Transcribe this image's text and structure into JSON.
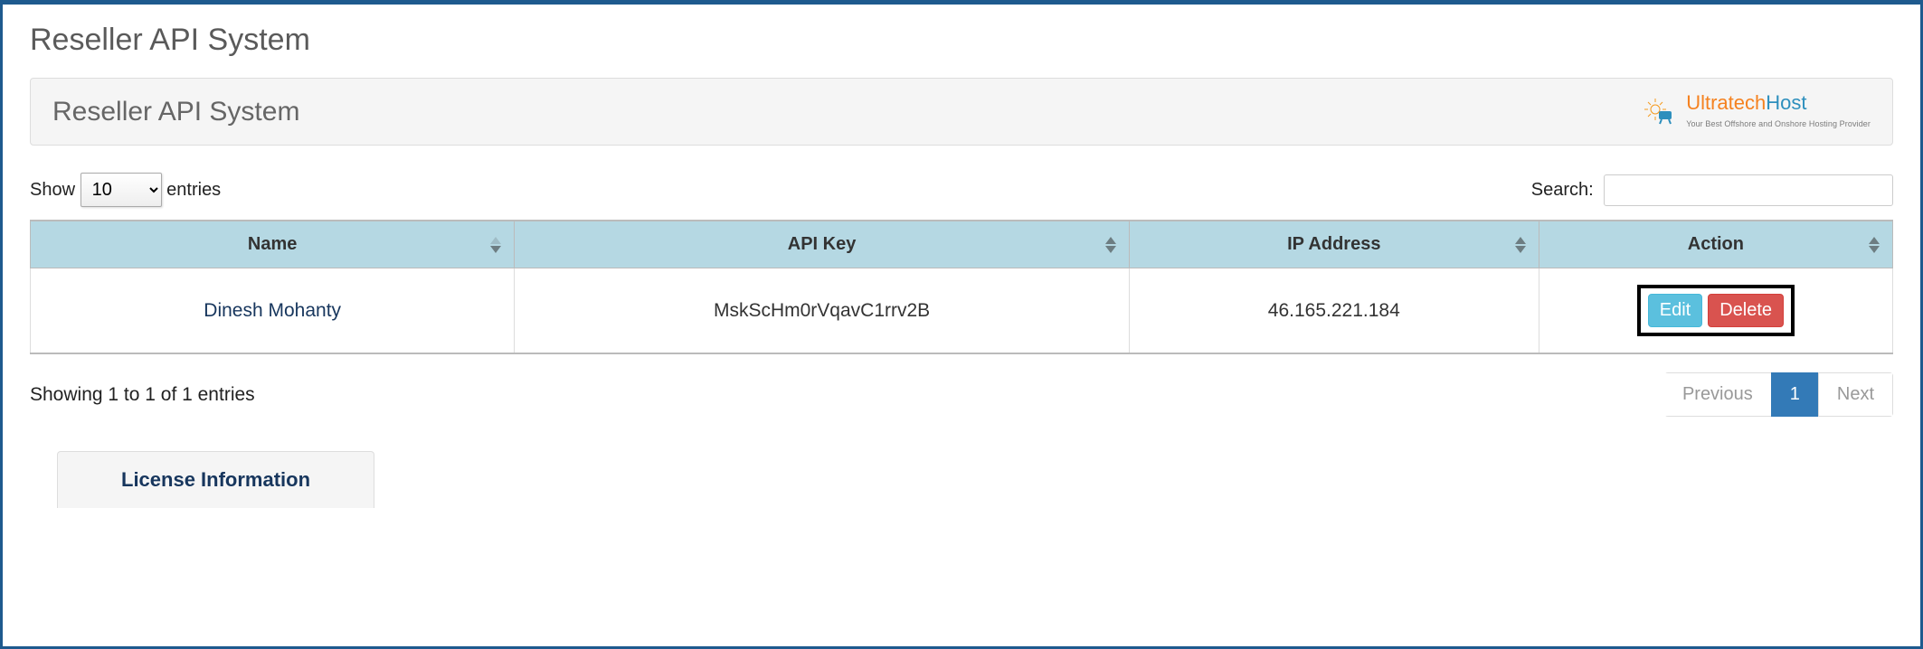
{
  "page": {
    "title": "Reseller API System"
  },
  "panel": {
    "title": "Reseller API System"
  },
  "brand": {
    "name_1": "Ultratech",
    "name_2": "Host",
    "tagline": "Your Best Offshore and Onshore Hosting Provider"
  },
  "controls": {
    "show_label_before": "Show",
    "show_label_after": "entries",
    "show_value": "10",
    "search_label": "Search:"
  },
  "table": {
    "headers": {
      "name": "Name",
      "apikey": "API Key",
      "ip": "IP Address",
      "action": "Action"
    },
    "rows": [
      {
        "name": "Dinesh Mohanty",
        "apikey": "MskScHm0rVqavC1rrv2B",
        "ip": "46.165.221.184"
      }
    ],
    "actions": {
      "edit": "Edit",
      "delete": "Delete"
    }
  },
  "footer": {
    "info": "Showing 1 to 1 of 1 entries"
  },
  "pagination": {
    "prev": "Previous",
    "next": "Next",
    "page1": "1"
  },
  "tabs": {
    "license": "License Information"
  }
}
